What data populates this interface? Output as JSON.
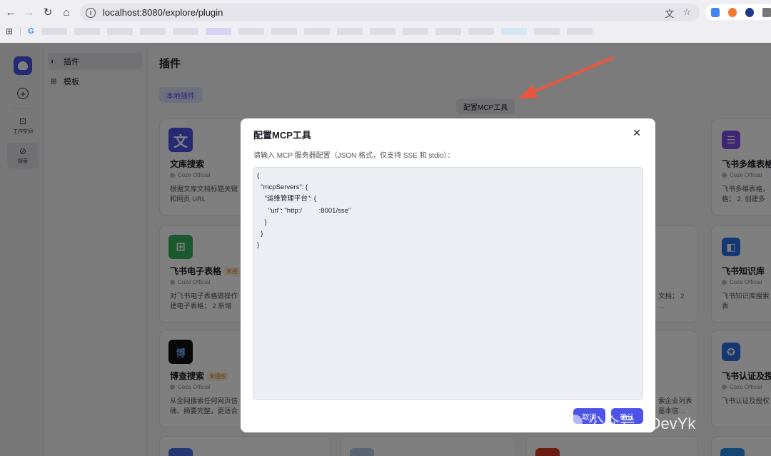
{
  "browser": {
    "url": "localhost:8080/explore/plugin"
  },
  "rail": {
    "items": [
      {
        "label": "工作空间"
      },
      {
        "label": "探索"
      }
    ]
  },
  "subnav": {
    "items": [
      {
        "label": "插件"
      },
      {
        "label": "模板"
      }
    ]
  },
  "main": {
    "title": "插件",
    "tab_local": "本地插件",
    "mcp_button": "配置MCP工具"
  },
  "cards": [
    {
      "icon": "文",
      "color": "#4d53e8",
      "name": "文库搜索",
      "badge": "",
      "source": "Coze Official",
      "desc": "根据文库文档标题关键\n和网页 URL"
    },
    {
      "icon": "⊞",
      "color": "#34b25a",
      "name": "飞书电子表格",
      "badge": "未授",
      "source": "Coze Official",
      "desc": "对飞书电子表格做操作\n建电子表格； 2.新增"
    },
    {
      "icon": "博",
      "color": "#111111",
      "name": "博查搜索",
      "badge": "未授权",
      "source": "Coze Official",
      "desc": "从全网搜索任何网页信\n确、摘要完整，更适合"
    },
    {
      "icon": "☰",
      "color": "#7c4de8",
      "name": "飞书多维表格",
      "badge": "",
      "source": "Coze Official",
      "desc": "飞书多维表格，\n格； 2. 创建多"
    },
    {
      "icon": "◧",
      "color": "#2b6fe8",
      "name": "飞书知识库",
      "badge": "",
      "source": "Coze Official",
      "desc": "飞书知识库搜索\n表"
    },
    {
      "icon": "✪",
      "color": "#2b6fe8",
      "name": "飞书认证及授",
      "badge": "",
      "source": "Coze Official",
      "desc": "飞书认证及授权"
    }
  ],
  "partial_desc": {
    "mid_a": "文档； 2.\n…",
    "mid_b": "索企业列表\n基本信…"
  },
  "modal": {
    "title": "配置MCP工具",
    "hint": "请输入 MCP 服务器配置（JSON 格式，仅支持 SSE 和 stdio）：",
    "config": "{\n  \"mcpServers\": {\n    \"运维管理平台\": {\n      \"url\": \"http:/         :8001/sse\"\n    }\n  }\n}",
    "cancel": "取消",
    "confirm": "确认"
  },
  "watermark": "公众号 · DevYk",
  "colors": {
    "accent": "#4d53e8",
    "annotation_arrow": "#e8563f"
  }
}
